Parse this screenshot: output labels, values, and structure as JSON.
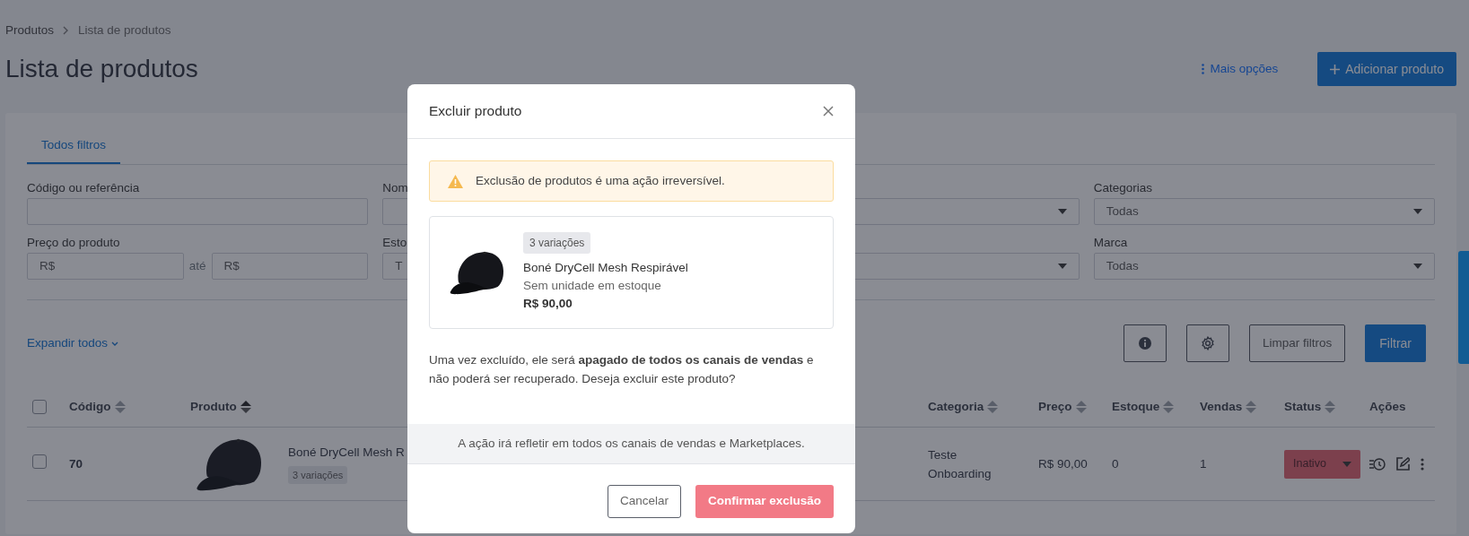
{
  "breadcrumb": [
    {
      "label": "Produtos"
    },
    {
      "label": "Lista de produtos"
    }
  ],
  "page_title": "Lista de produtos",
  "header_actions": {
    "more_options": "Mais opções",
    "add_button": "Adicionar produto"
  },
  "filter_tabs": [
    {
      "label": "Todos filtros",
      "selected": true
    }
  ],
  "filters": [
    {
      "kind": "text",
      "label": "Código ou referência"
    },
    {
      "kind": "text",
      "label": "Nom"
    },
    {
      "kind": "select"
    },
    {
      "kind": "select",
      "label": "Categorias",
      "value": "Todas"
    },
    {
      "kind": "range",
      "label": "Preço do produto",
      "from_placeholder": "R$",
      "separator": "até",
      "to_placeholder": "R$"
    },
    {
      "kind": "select",
      "label": "Esto",
      "value": "T"
    },
    {
      "kind": "select"
    },
    {
      "kind": "select",
      "label": "Marca",
      "value": "Todas"
    }
  ],
  "expand_all": "Expandir todos",
  "toolbar": {
    "clear": "Limpar filtros",
    "filter": "Filtrar"
  },
  "table": {
    "all_checked": false,
    "columns": [
      {
        "label": "Código",
        "sorted": false
      },
      {
        "label": "Produto",
        "sorted": true
      },
      {
        "label": "Categoria",
        "sorted": false
      },
      {
        "label": "Preço",
        "sorted": false
      },
      {
        "label": "Estoque",
        "sorted": false
      },
      {
        "label": "Vendas",
        "sorted": false
      },
      {
        "label": "Status",
        "sorted": false
      },
      {
        "label": "Ações"
      }
    ],
    "rows": [
      {
        "checked": false,
        "code": "70",
        "product": "Boné DryCell Mesh R",
        "variations": "3 variações",
        "category": "Teste Onboarding",
        "price": "R$ 90,00",
        "stock": "0",
        "sales": "1",
        "status": "Inativo"
      }
    ]
  },
  "modal": {
    "title": "Excluir produto",
    "alert": "Exclusão de produtos é uma ação irreversível.",
    "product": {
      "variations": "3 variações",
      "name": "Boné DryCell Mesh Respirável",
      "stock": "Sem unidade em estoque",
      "price": "R$ 90,00"
    },
    "message": "Uma vez excluído, ele será **apagado de todos os canais de vendas** e não poderá ser recuperado. Deseja excluir este produto?",
    "note": "A ação irá refletir em todos os canais de vendas e Marketplaces.",
    "buttons": {
      "cancel": "Cancelar",
      "confirm": "Confirmar exclusão"
    }
  }
}
